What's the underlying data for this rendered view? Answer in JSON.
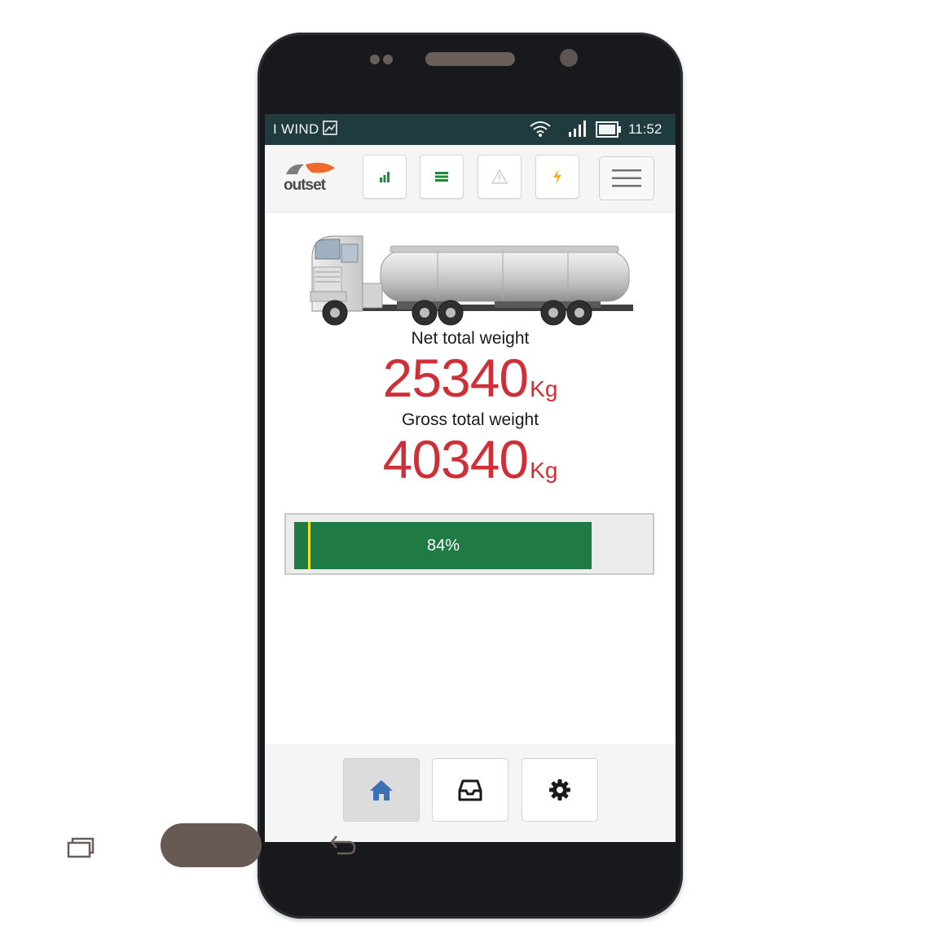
{
  "statusbar": {
    "carrier": "I WIND",
    "time": "11:52",
    "icons": [
      "image-icon",
      "wifi-icon",
      "signal-icon",
      "battery-icon"
    ]
  },
  "appbar": {
    "logo_text": "outset",
    "toolbar": [
      {
        "name": "signal-bars-icon",
        "color": "#1f8a3c"
      },
      {
        "name": "list-icon",
        "color": "#1f8a3c"
      },
      {
        "name": "warning-icon",
        "color": "#cfcfcf"
      },
      {
        "name": "lightning-icon",
        "color": "#f3b21a"
      }
    ],
    "menu_icon": "hamburger-icon"
  },
  "main": {
    "image": "tanker-truck",
    "net_label": "Net total weight",
    "net_value": "25340",
    "net_unit": "Kg",
    "gross_label": "Gross total weight",
    "gross_value": "40340",
    "gross_unit": "Kg",
    "progress": {
      "text": "84%",
      "value": 0.84,
      "fill_color": "#1f7a43",
      "marker_color": "#f2e21a"
    }
  },
  "bottom_nav": [
    {
      "name": "home-icon",
      "active": true,
      "color": "#3b6fb6"
    },
    {
      "name": "inbox-icon",
      "active": false,
      "color": "#1a1a1a"
    },
    {
      "name": "gear-icon",
      "active": false,
      "color": "#1a1a1a"
    }
  ],
  "colors": {
    "accent_red": "#cf2f36",
    "status_bar": "#1f3b3d"
  }
}
